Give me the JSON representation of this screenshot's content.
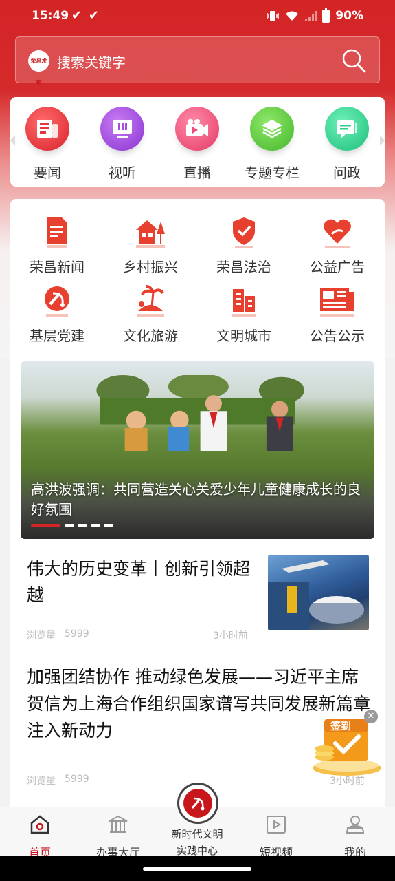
{
  "status_bar": {
    "time": "15:49",
    "battery": "90%"
  },
  "search": {
    "logo_text": "荣昌发布",
    "placeholder": "搜索关键字"
  },
  "channels": [
    {
      "label": "要闻",
      "icon": "news-icon",
      "color": "#e8343c"
    },
    {
      "label": "视听",
      "icon": "monitor-icon",
      "color": "#a44be0"
    },
    {
      "label": "直播",
      "icon": "video-camera-icon",
      "color": "#ee4d7a"
    },
    {
      "label": "专题专栏",
      "icon": "layers-icon",
      "color": "#5fcf3d"
    },
    {
      "label": "问政",
      "icon": "chat-icon",
      "color": "#2fcf8d"
    }
  ],
  "categories": [
    {
      "label": "荣昌新闻",
      "icon": "document-icon"
    },
    {
      "label": "乡村振兴",
      "icon": "farmhouse-icon"
    },
    {
      "label": "荣昌法治",
      "icon": "shield-check-icon"
    },
    {
      "label": "公益广告",
      "icon": "heart-hand-icon"
    },
    {
      "label": "基层党建",
      "icon": "party-emblem-icon"
    },
    {
      "label": "文化旅游",
      "icon": "island-icon"
    },
    {
      "label": "文明城市",
      "icon": "buildings-icon"
    },
    {
      "label": "公告公示",
      "icon": "newspaper-icon"
    }
  ],
  "banner": {
    "caption": "高洪波强调：共同营造关心关爱少年儿童健康成长的良好氛围",
    "slide_count": 5,
    "active_slide": 1
  },
  "articles": [
    {
      "title": "伟大的历史变革丨创新引领超越",
      "views_label": "浏览量",
      "views": "5999",
      "time": "3小时前"
    },
    {
      "title": "加强团结协作 推动绿色发展——习近平主席贺信为上海合作组织国家谱写共同发展新篇章注入新动力",
      "views_label": "浏览量",
      "views": "5999",
      "time": "3小时前"
    }
  ],
  "signin": {
    "label": "签到"
  },
  "bottom_nav": [
    {
      "label": "首页",
      "icon": "home-icon",
      "active": true
    },
    {
      "label": "办事大厅",
      "icon": "government-building-icon",
      "active": false
    },
    {
      "label": "新时代文明实践中心",
      "line1": "新时代文明",
      "line2": "实践中心",
      "icon": "party-emblem-icon",
      "active": false
    },
    {
      "label": "短视频",
      "icon": "play-icon",
      "active": false
    },
    {
      "label": "我的",
      "icon": "user-icon",
      "active": false
    }
  ],
  "colors": {
    "brand_red": "#c8161d",
    "icon_red": "#e8402e"
  }
}
